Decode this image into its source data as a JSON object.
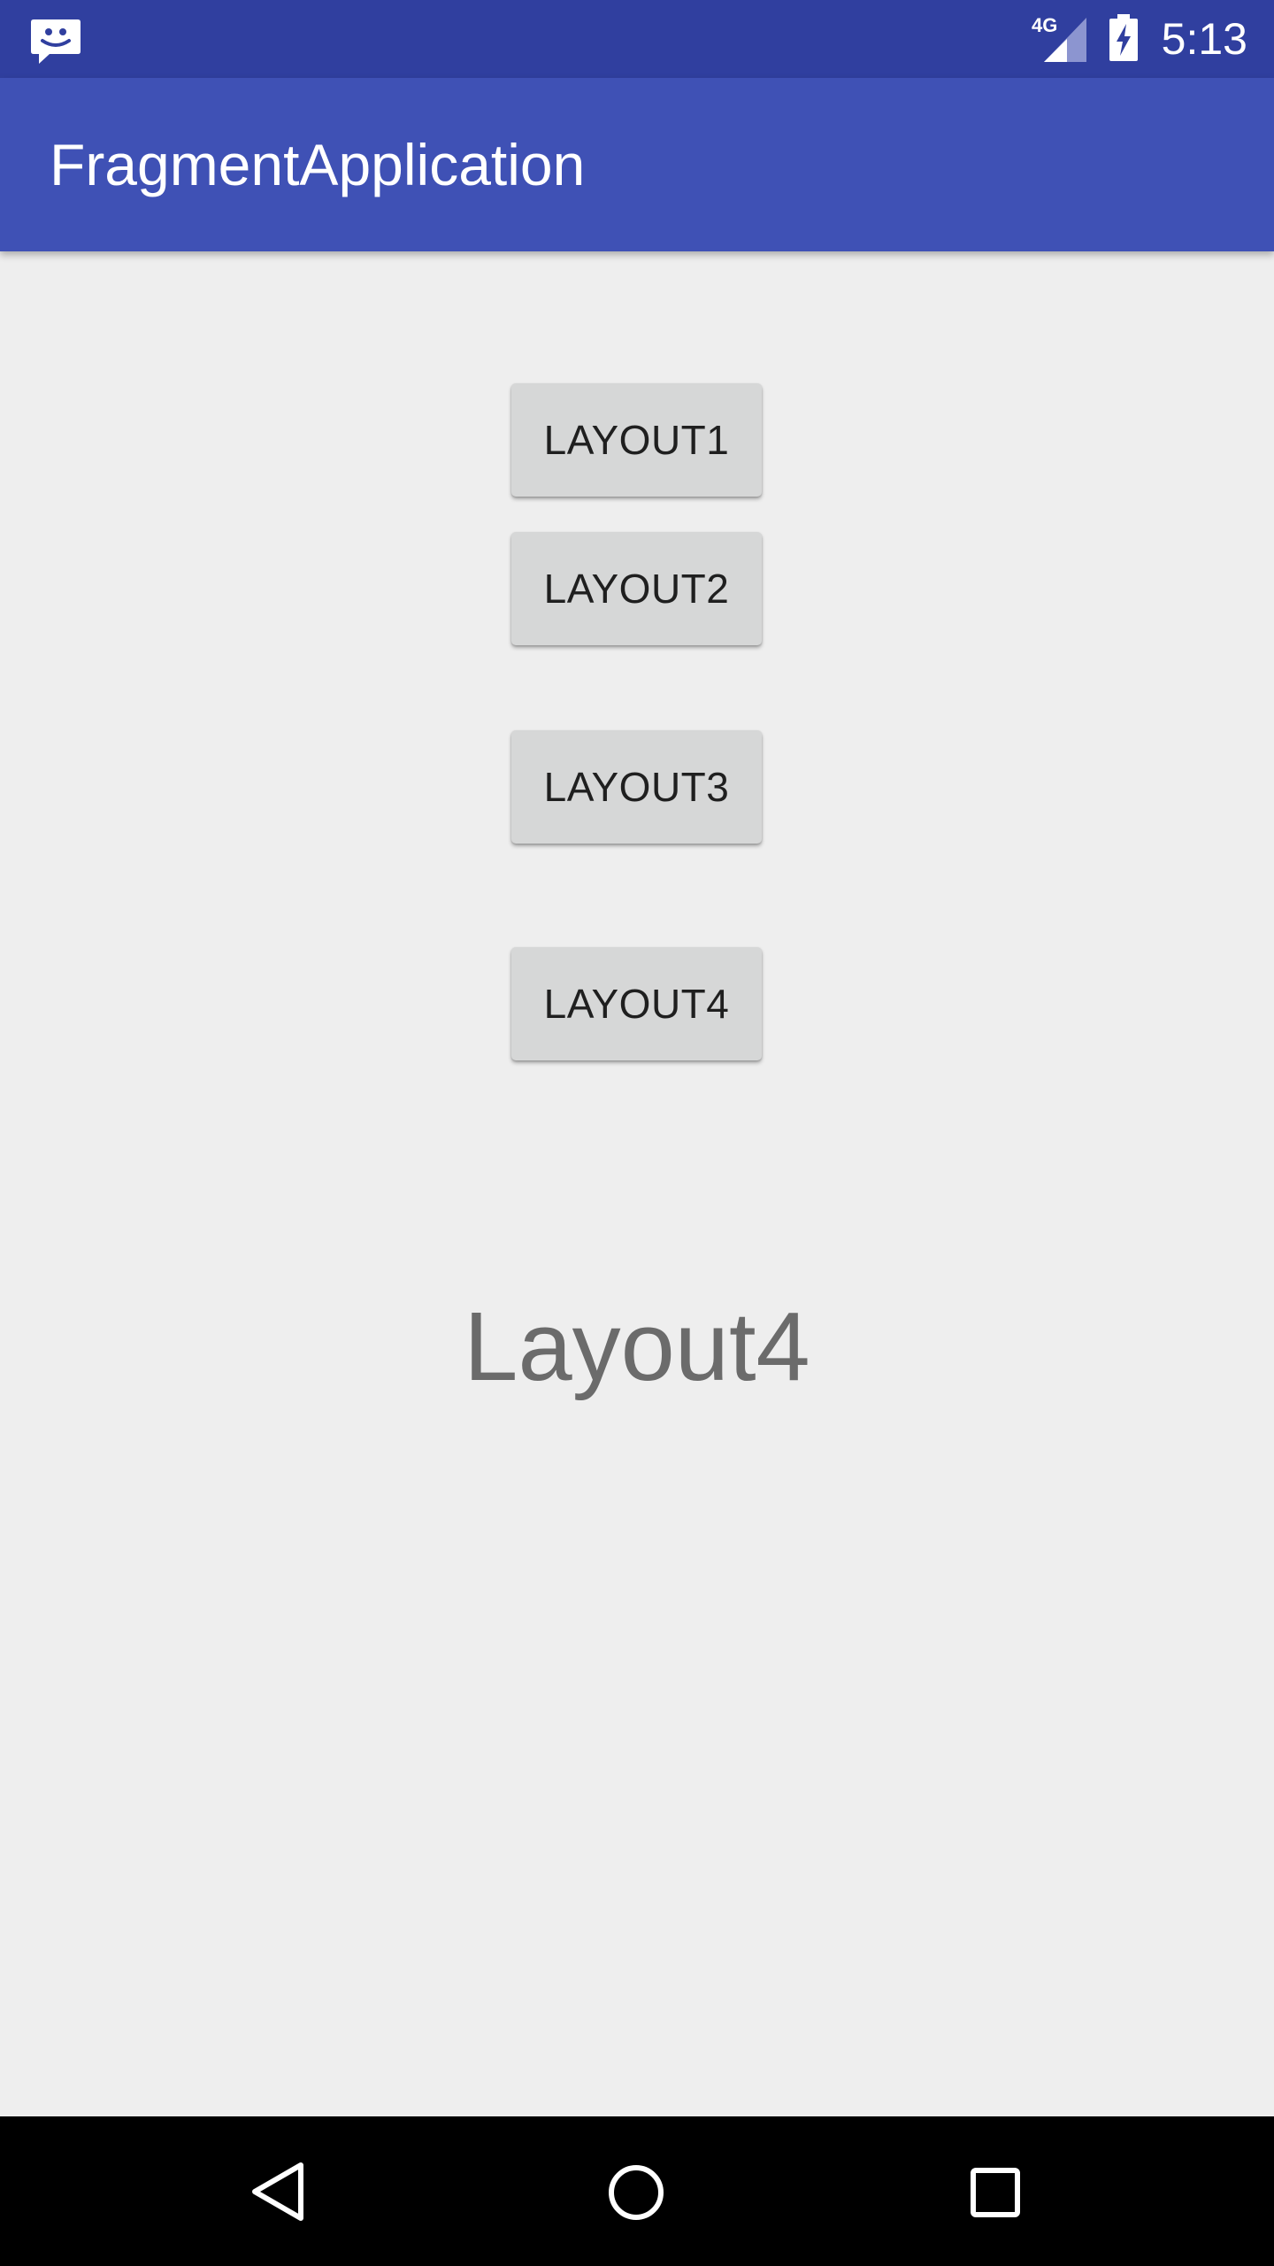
{
  "status_bar": {
    "network_type": "4G",
    "time": "5:13",
    "icons": [
      "notification-message-icon",
      "signal-icon",
      "battery-charging-icon"
    ]
  },
  "app_bar": {
    "title": "FragmentApplication"
  },
  "buttons": [
    {
      "label": "LAYOUT1"
    },
    {
      "label": "LAYOUT2"
    },
    {
      "label": "LAYOUT3"
    },
    {
      "label": "LAYOUT4"
    }
  ],
  "fragment": {
    "text": "Layout4"
  },
  "nav_bar": {
    "icons": [
      "back-icon",
      "home-icon",
      "recents-icon"
    ]
  },
  "colors": {
    "status_bar": "#303f9f",
    "app_bar": "#3f51b5",
    "background": "#eeeeee",
    "button": "#d6d7d7",
    "fragment_text": "#6b6b6b",
    "nav_bar": "#000000"
  }
}
